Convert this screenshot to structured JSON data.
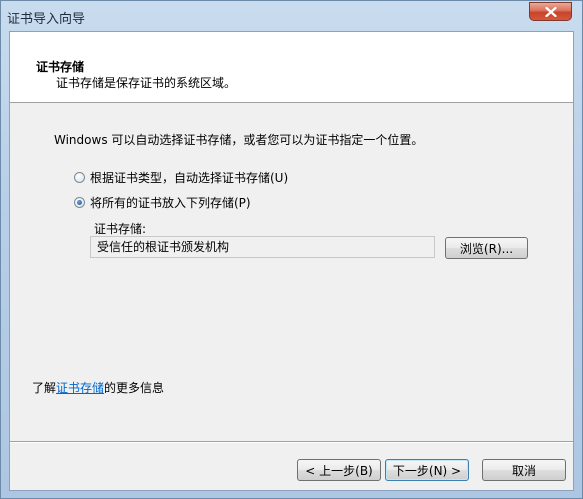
{
  "window": {
    "title": "证书导入向导"
  },
  "header": {
    "title": "证书存储",
    "subtitle": "证书存储是保存证书的系统区域。"
  },
  "body": {
    "description": "Windows 可以自动选择证书存储，或者您可以为证书指定一个位置。",
    "options": [
      {
        "label": "根据证书类型，自动选择证书存储(U)",
        "checked": false
      },
      {
        "label": "将所有的证书放入下列存储(P)",
        "checked": true
      }
    ],
    "store_label": "证书存储:",
    "store_value": "受信任的根证书颁发机构",
    "browse_label": "浏览(R)...",
    "help_prefix": "了解",
    "help_link": "证书存储",
    "help_suffix": "的更多信息"
  },
  "buttons": {
    "back_label": "< 上一步(B)",
    "next_label": "下一步(N) >",
    "cancel_label": "取消"
  }
}
